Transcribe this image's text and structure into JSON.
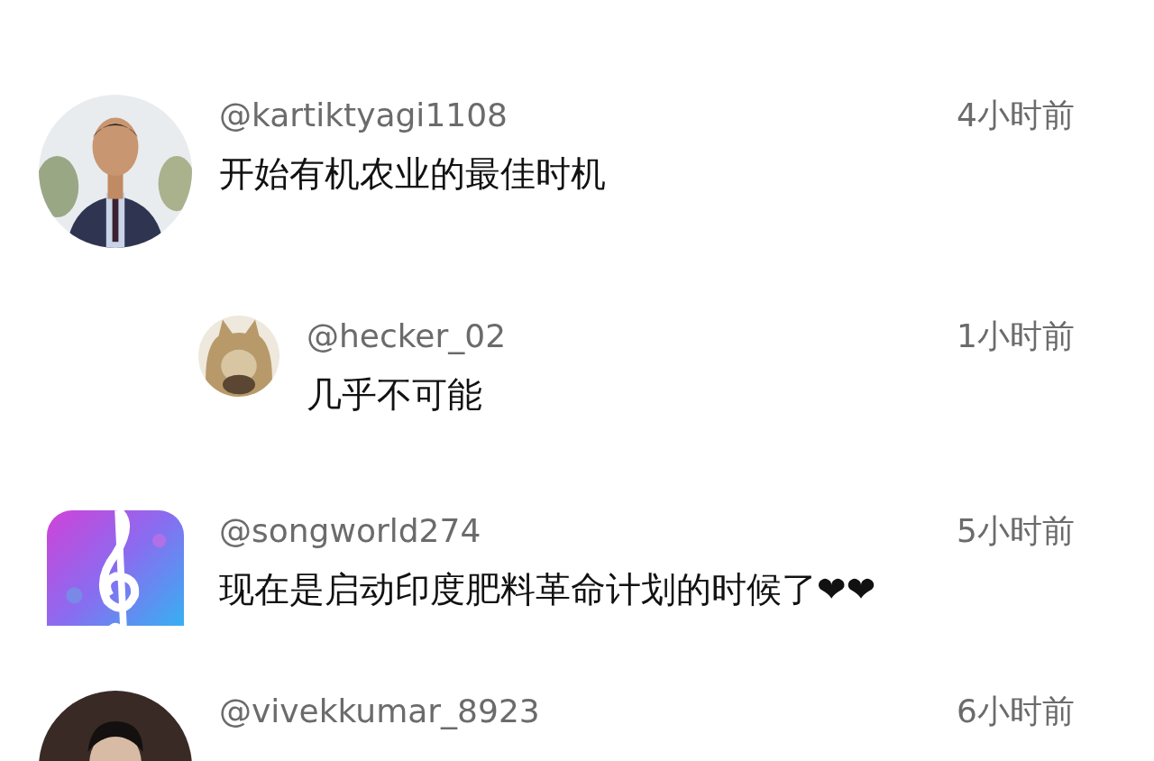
{
  "comments": [
    {
      "kind": "comment",
      "username": "@kartiktyagi1108",
      "time": "4小时前",
      "text": "开始有机农业的最佳时机"
    },
    {
      "kind": "reply",
      "username": "@hecker_02",
      "time": "1小时前",
      "text": "几乎不可能"
    },
    {
      "kind": "comment",
      "username": "@songworld274",
      "time": "5小时前",
      "text": "现在是启动印度肥料革命计划的时候了❤❤"
    },
    {
      "kind": "comment",
      "username": "@vivekkumar_8923",
      "time": "6小时前"
    }
  ]
}
